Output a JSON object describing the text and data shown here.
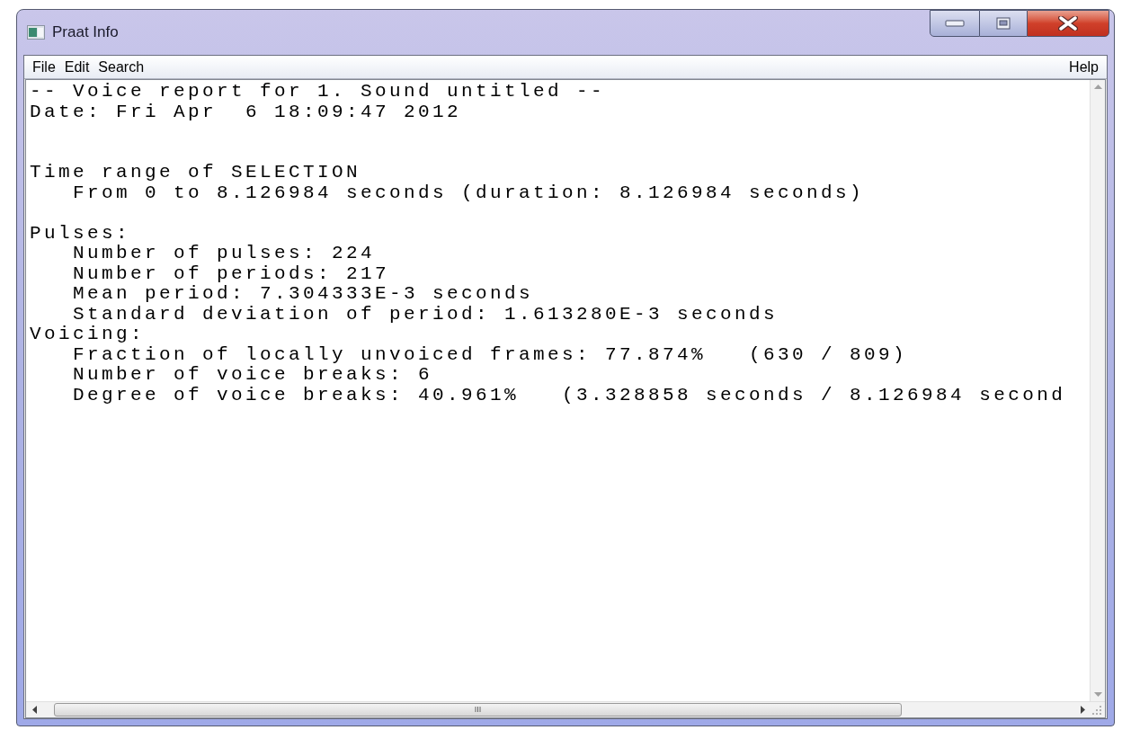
{
  "window": {
    "title": "Praat Info"
  },
  "menu": {
    "left": [
      "File",
      "Edit",
      "Search"
    ],
    "right": [
      "Help"
    ]
  },
  "report": {
    "blocks": [
      {
        "lines": [
          {
            "text": "-- Voice report for 1. Sound untitled --",
            "indented": false
          },
          {
            "text": "Date: Fri Apr  6 18:09:47 2012",
            "indented": false
          }
        ]
      },
      {
        "lines": [
          {
            "text": "Time range of SELECTION",
            "indented": false
          },
          {
            "text": "From 0 to 8.126984 seconds (duration: 8.126984 seconds)",
            "indented": true
          }
        ]
      },
      {
        "lines": [
          {
            "text": "Pulses:",
            "indented": false
          },
          {
            "text": "Number of pulses: 224",
            "indented": true
          },
          {
            "text": "Number of periods: 217",
            "indented": true
          },
          {
            "text": "Mean period: 7.304333E-3 seconds",
            "indented": true
          },
          {
            "text": "Standard deviation of period: 1.613280E-3 seconds",
            "indented": true
          },
          {
            "text": "Voicing:",
            "indented": false
          },
          {
            "text": "Fraction of locally unvoiced frames: 77.874%   (630 / 809)",
            "indented": true
          },
          {
            "text": "Number of voice breaks: 6",
            "indented": true
          },
          {
            "text": "Degree of voice breaks: 40.961%   (3.328858 seconds / 8.126984 second",
            "indented": true
          }
        ]
      }
    ]
  },
  "scrollbar": {
    "grip": "III"
  }
}
